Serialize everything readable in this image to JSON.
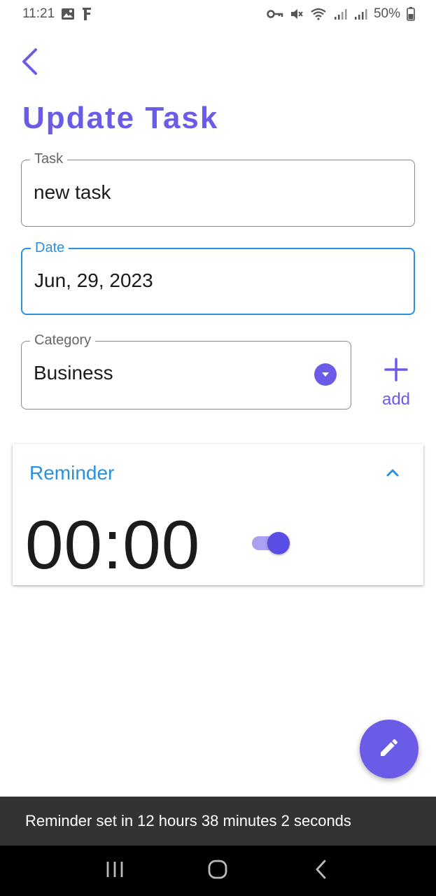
{
  "status_bar": {
    "time": "11:21",
    "battery": "50%",
    "left_icons": [
      "image-icon",
      "p-app-icon"
    ],
    "right_icons": [
      "key-icon",
      "mute-icon",
      "wifi-icon",
      "signal-icon",
      "signal-icon",
      "battery-icon"
    ]
  },
  "header": {
    "back_icon": "chevron-left-icon",
    "title": "Update Task"
  },
  "form": {
    "task": {
      "label": "Task",
      "value": "new task"
    },
    "date": {
      "label": "Date",
      "value": "Jun, 29, 2023",
      "focused": true
    },
    "category": {
      "label": "Category",
      "value": "Business",
      "dropdown_icon": "dropdown-arrow-icon"
    },
    "add": {
      "icon": "plus-icon",
      "label": "add"
    }
  },
  "reminder": {
    "title": "Reminder",
    "collapse_icon": "chevron-up-icon",
    "time": "00:00",
    "enabled": true
  },
  "fab": {
    "icon": "pencil-icon"
  },
  "snackbar": {
    "message": "Reminder set in 12 hours 38 minutes 2 seconds"
  },
  "nav_bar": {
    "buttons": [
      "recent-apps-icon",
      "home-icon",
      "back-icon"
    ]
  },
  "colors": {
    "accent": "#6b5ce7",
    "focus_blue": "#2a90e0",
    "snackbar_bg": "#333333"
  }
}
